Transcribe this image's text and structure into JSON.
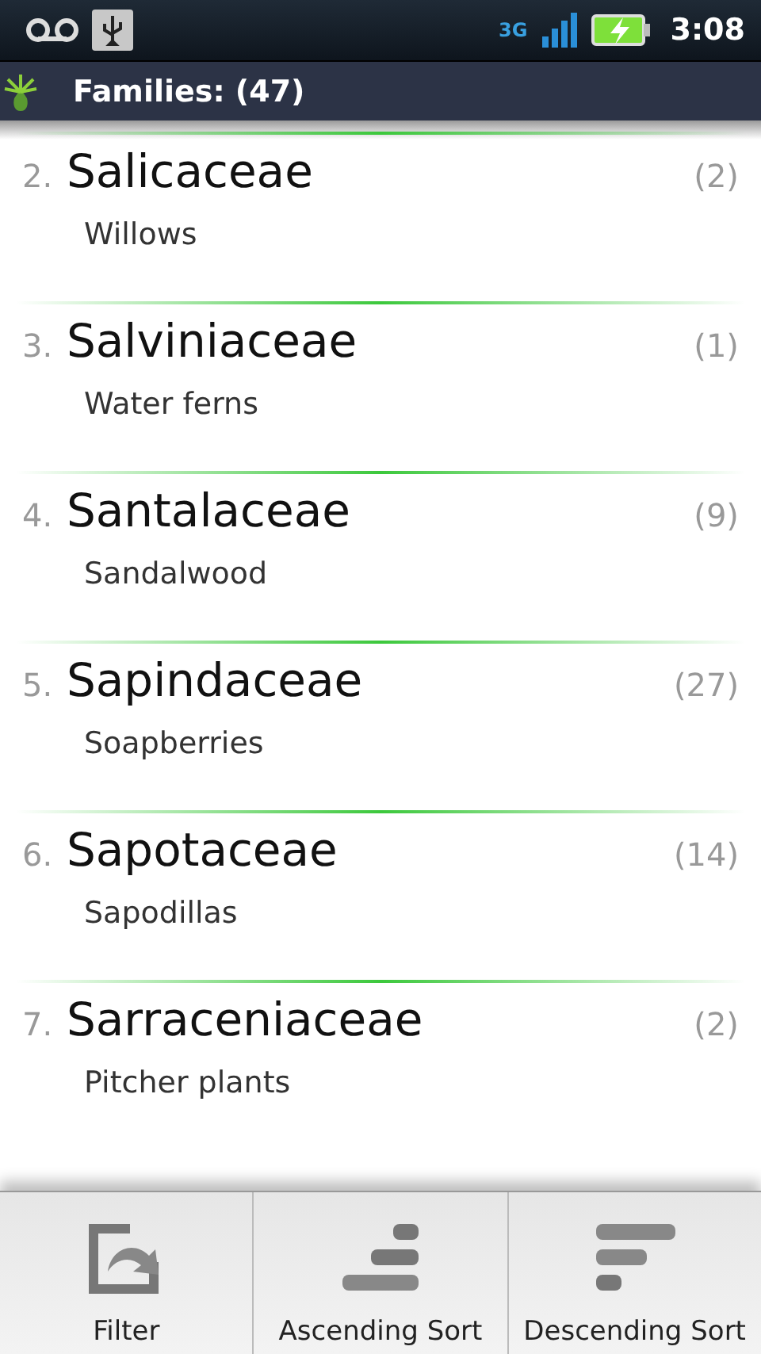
{
  "status_bar": {
    "network": "3G",
    "time": "3:08"
  },
  "title_bar": {
    "title": "Families: (47)"
  },
  "families": [
    {
      "index": "2.",
      "name": "Salicaceae",
      "count": "(2)",
      "common_name": "Willows"
    },
    {
      "index": "3.",
      "name": "Salviniaceae",
      "count": "(1)",
      "common_name": "Water ferns"
    },
    {
      "index": "4.",
      "name": "Santalaceae",
      "count": "(9)",
      "common_name": "Sandalwood"
    },
    {
      "index": "5.",
      "name": "Sapindaceae",
      "count": "(27)",
      "common_name": "Soapberries"
    },
    {
      "index": "6.",
      "name": "Sapotaceae",
      "count": "(14)",
      "common_name": "Sapodillas"
    },
    {
      "index": "7.",
      "name": "Sarraceniaceae",
      "count": "(2)",
      "common_name": "Pitcher plants"
    }
  ],
  "menu": [
    {
      "kind": "filter",
      "label": "Filter"
    },
    {
      "kind": "ascending",
      "label": "Ascending Sort"
    },
    {
      "kind": "descending",
      "label": "Descending Sort"
    }
  ]
}
